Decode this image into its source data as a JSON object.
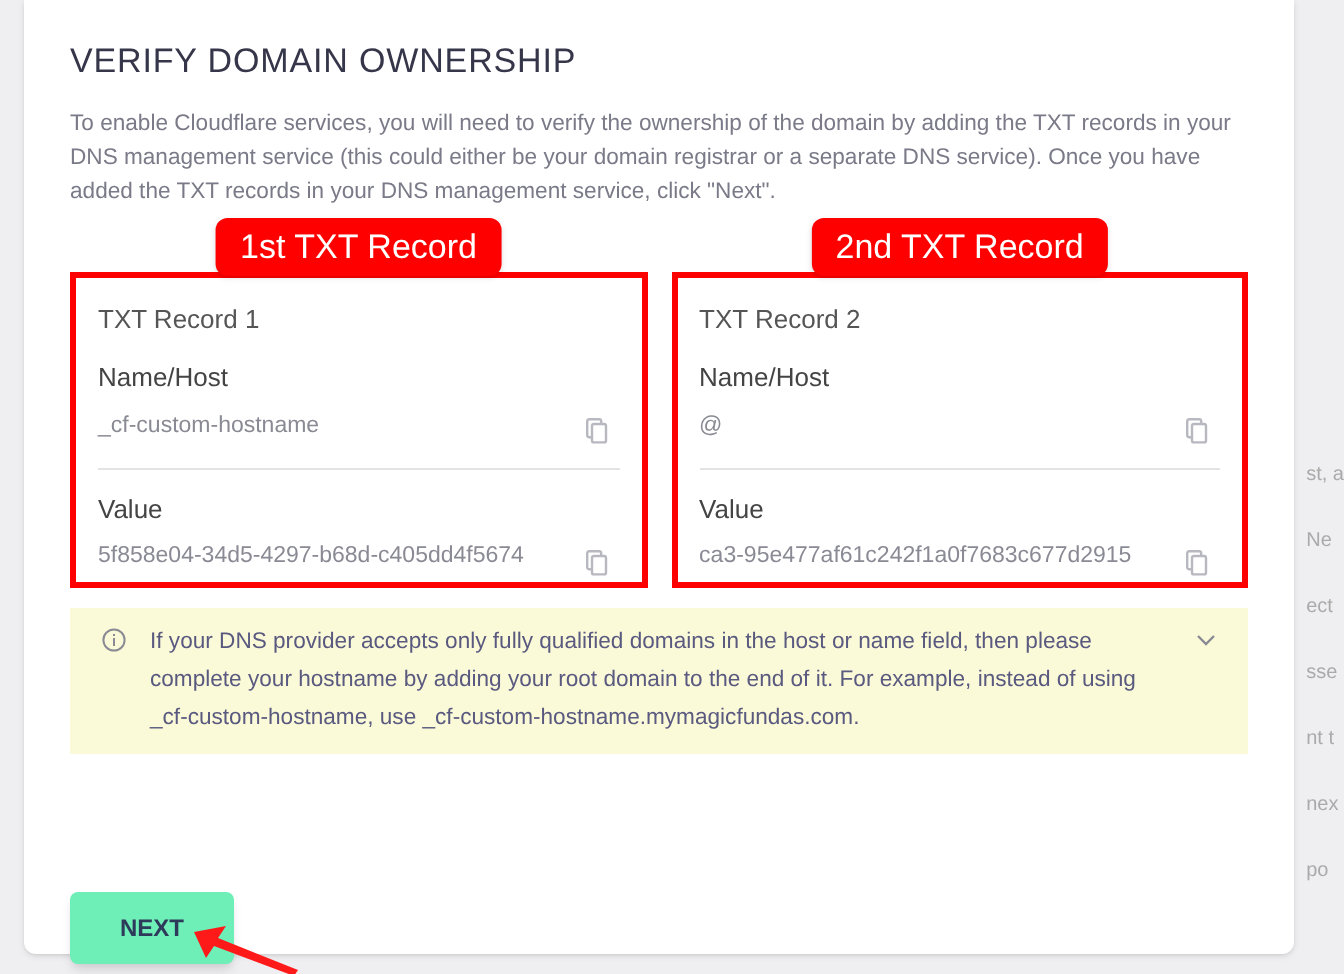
{
  "title": "VERIFY DOMAIN OWNERSHIP",
  "intro": "To enable Cloudflare services, you will need to verify the ownership of the domain by adding the TXT records in your DNS management service (this could either be your domain registrar or a separate DNS service). Once you have added the TXT records in your DNS management service, click \"Next\".",
  "records": [
    {
      "annotation": "1st TXT Record",
      "heading": "TXT Record 1",
      "name_label": "Name/Host",
      "name_value": "_cf-custom-hostname",
      "value_label": "Value",
      "value": "5f858e04-34d5-4297-b68d-c405dd4f5674"
    },
    {
      "annotation": "2nd TXT Record",
      "heading": "TXT Record 2",
      "name_label": "Name/Host",
      "name_value": "@",
      "value_label": "Value",
      "value": "ca3-95e477af61c242f1a0f7683c677d2915"
    }
  ],
  "note": {
    "text": "If your DNS provider accepts only fully qualified domains in the host or name field, then please complete your hostname by adding your root domain to the end of it. For example, instead of using _cf-custom-hostname, use _cf-custom-hostname.mymagicfundas.com.",
    "expanded": false
  },
  "next_button": "NEXT",
  "background_fragments": [
    "st, a",
    "Ne",
    "ect",
    "sse",
    "nt t",
    "nex",
    "po"
  ]
}
